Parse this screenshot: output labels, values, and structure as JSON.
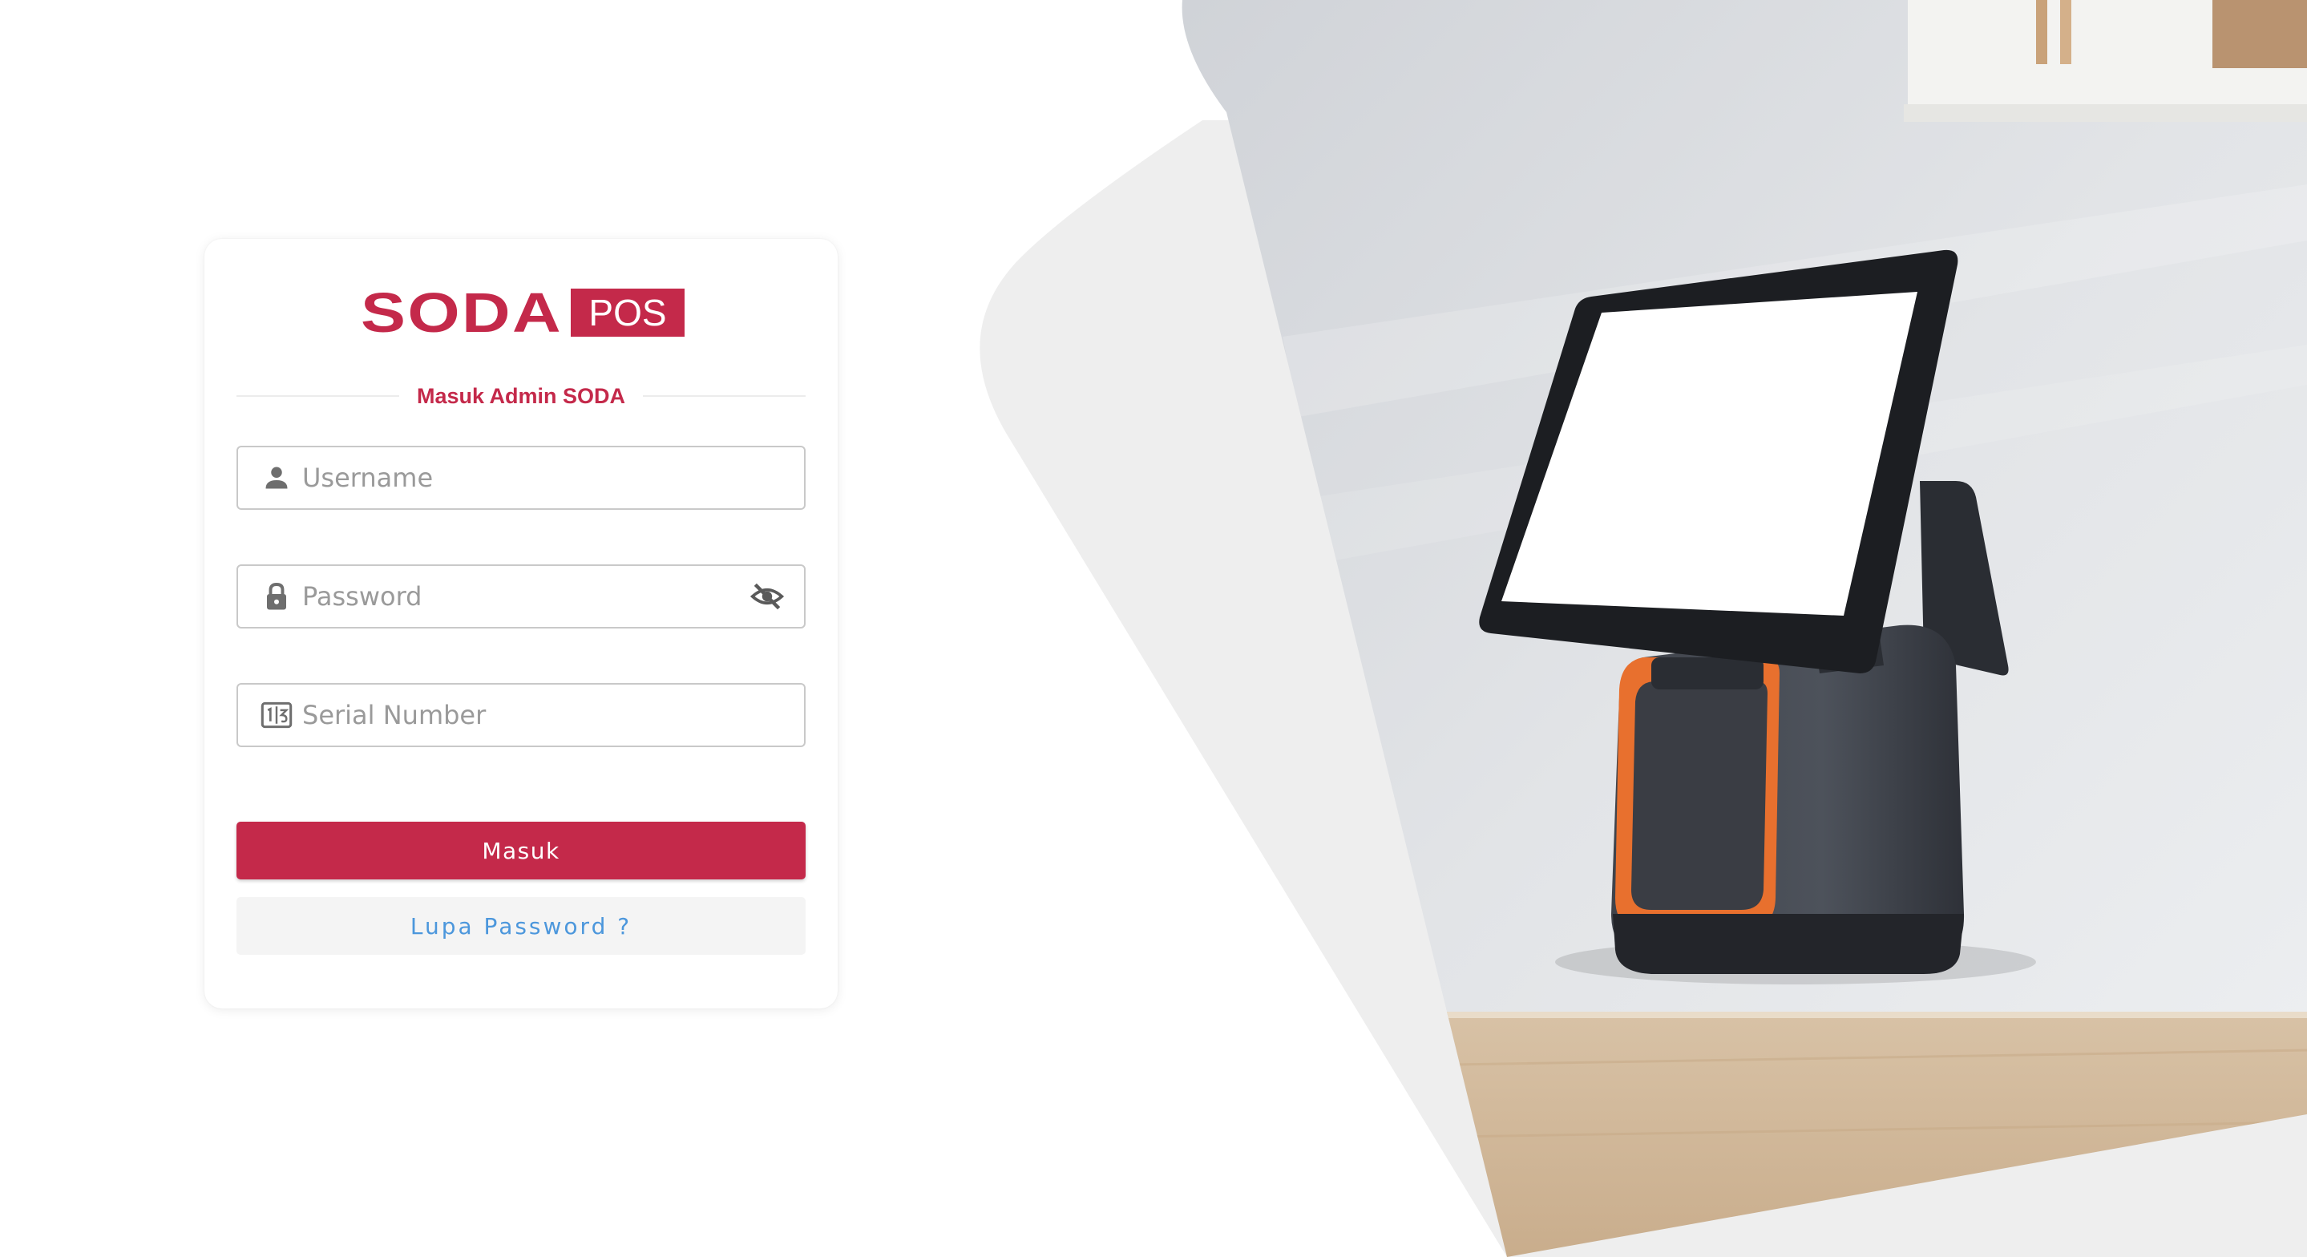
{
  "brand": {
    "logo_primary": "SODA",
    "logo_secondary": "POS",
    "accent_color": "#c4294a"
  },
  "login": {
    "title": "Masuk Admin SODA",
    "username": {
      "placeholder": "Username",
      "value": "",
      "icon": "user-icon"
    },
    "password": {
      "placeholder": "Password",
      "value": "",
      "icon": "lock-icon",
      "toggle_icon": "eye-off-icon"
    },
    "serial": {
      "placeholder": "Serial Number",
      "value": "",
      "icon": "serial-number-icon"
    },
    "submit_label": "Masuk",
    "forgot_label": "Lupa Password ?"
  },
  "colors": {
    "button_bg": "#c4294a",
    "link_color": "#4c97dc",
    "backdrop": "#eeeeee"
  }
}
